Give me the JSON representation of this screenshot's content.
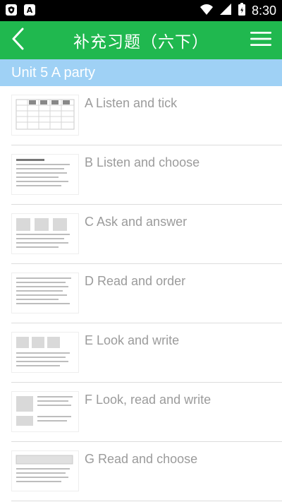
{
  "status_bar": {
    "time": "8:30",
    "left_icons": [
      "shield-icon",
      "a-icon"
    ],
    "right_icons": [
      "wifi-icon",
      "signal-icon",
      "battery-icon"
    ],
    "left_icon_text": [
      "",
      "A"
    ]
  },
  "app_bar": {
    "title": "补充习题（六下）",
    "back_icon": "chevron-left-icon",
    "menu_icon": "menu-icon",
    "color": "#20b84f"
  },
  "unit": {
    "title": "Unit 5 A party",
    "color": "#9fd1f5"
  },
  "items": [
    {
      "label": "A Listen and tick"
    },
    {
      "label": "B Listen and choose"
    },
    {
      "label": "C Ask and answer"
    },
    {
      "label": "D Read and order"
    },
    {
      "label": "E Look and write"
    },
    {
      "label": "F Look, read and write"
    },
    {
      "label": "G Read and choose"
    }
  ]
}
